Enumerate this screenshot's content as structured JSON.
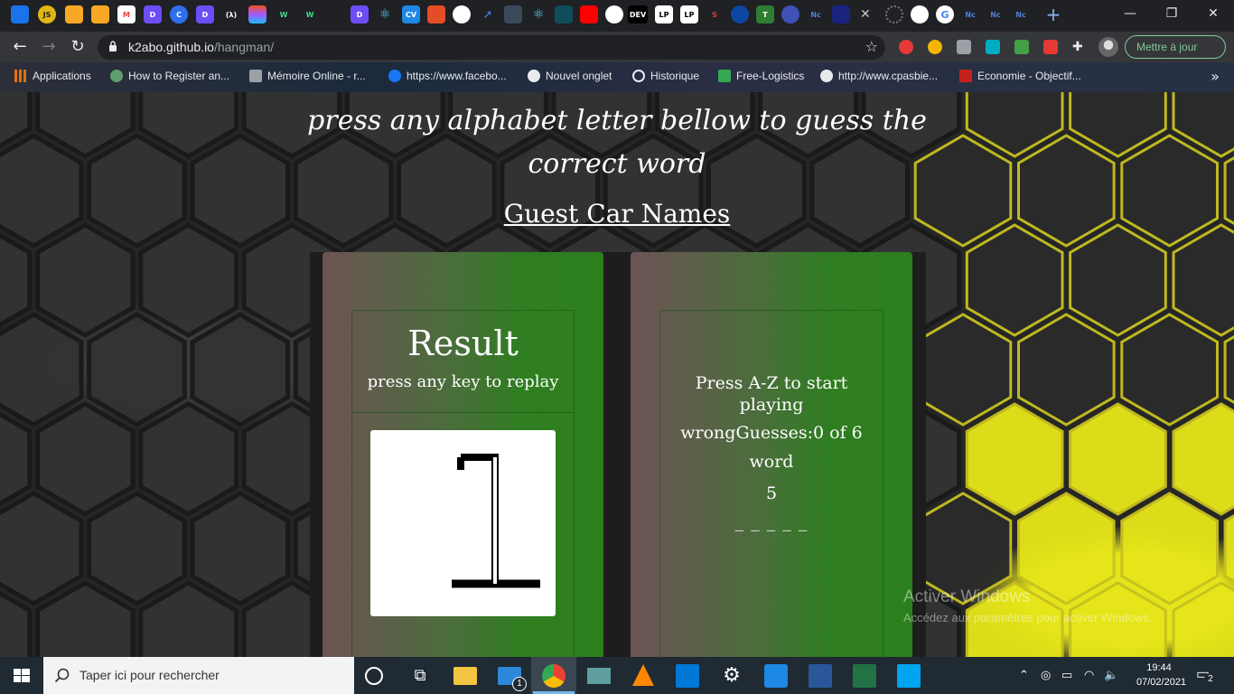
{
  "browser": {
    "tabs": [
      {
        "icon": "cloud-icon"
      },
      {
        "icon": "js-icon",
        "text": "JS"
      },
      {
        "icon": "firebase-icon"
      },
      {
        "icon": "firebase-icon"
      },
      {
        "icon": "gmail-icon",
        "text": "M"
      },
      {
        "icon": "dash-icon",
        "text": "D"
      },
      {
        "icon": "c-icon",
        "text": "C"
      },
      {
        "icon": "dash-icon",
        "text": "D"
      },
      {
        "icon": "lambda-icon",
        "text": "(λ)"
      },
      {
        "icon": "figma-icon"
      },
      {
        "icon": "w-icon",
        "text": "W"
      },
      {
        "icon": "w-icon",
        "text": "W"
      },
      {
        "icon": "dash-icon",
        "text": "D"
      },
      {
        "icon": "react-icon"
      },
      {
        "icon": "cv-icon",
        "text": "CV"
      },
      {
        "icon": "html-icon"
      },
      {
        "icon": "github-icon"
      },
      {
        "icon": "bolt-icon"
      },
      {
        "icon": "vue-icon"
      },
      {
        "icon": "react-icon"
      },
      {
        "icon": "box-icon"
      },
      {
        "icon": "youtube-icon"
      },
      {
        "icon": "github-icon"
      },
      {
        "icon": "dev-icon",
        "text": "DEV"
      },
      {
        "icon": "lp-icon",
        "text": "LP"
      },
      {
        "icon": "lp-icon",
        "text": "LP"
      },
      {
        "icon": "s-icon",
        "text": "S"
      },
      {
        "icon": "pause-icon"
      },
      {
        "icon": "t-icon",
        "text": "T"
      },
      {
        "icon": "blue-circle-icon"
      },
      {
        "icon": "n-icon",
        "text": "Nc"
      },
      {
        "icon": "word-icon"
      }
    ],
    "tabs_tail": [
      {
        "icon": "loading-icon"
      },
      {
        "icon": "github-icon"
      },
      {
        "icon": "google-icon"
      },
      {
        "text": "Nc"
      },
      {
        "text": "Nc"
      },
      {
        "text": "Nc"
      }
    ],
    "url_host": "k2abo.github.io",
    "url_path": "/hangman/",
    "update_label": "Mettre à jour",
    "bookmarks": [
      {
        "label": "Applications",
        "icon_color": "#e8710a"
      },
      {
        "label": "How to Register an...",
        "icon_color": "#5f9e6e"
      },
      {
        "label": "Mémoire Online - r...",
        "icon_color": "#9aa0a6"
      },
      {
        "label": "https://www.facebo...",
        "icon_color": "#1877f2"
      },
      {
        "label": "Nouvel onglet",
        "icon_color": "#e8eaed"
      },
      {
        "label": "Historique",
        "icon_color": "#e8eaed"
      },
      {
        "label": "Free-Logistics",
        "icon_color": "#34a853"
      },
      {
        "label": "http://www.cpasbie...",
        "icon_color": "#e8eaed"
      },
      {
        "label": "Economie - Objectif...",
        "icon_color": "#c5221f"
      }
    ]
  },
  "page": {
    "tagline": "press any alphabet letter bellow to guess the correct word",
    "heading": "Guest Car Names",
    "result": {
      "title": "Result",
      "subtitle": "press any key to replay",
      "image_glyph": "1"
    },
    "status": {
      "prompt": "Press A-Z to start playing",
      "wrong_guesses": "wrongGuesses:0 of 6",
      "word_label": "word",
      "word_length": "5",
      "blanks": "_ _ _ _ _"
    }
  },
  "watermark": {
    "line1": "Activer Windows",
    "line2": "Accédez aux paramètres pour activer Windows."
  },
  "taskbar": {
    "search_placeholder": "Taper ici pour rechercher",
    "mail_badge": "1",
    "time": "19:44",
    "date": "07/02/2021",
    "notification_count": "2"
  }
}
